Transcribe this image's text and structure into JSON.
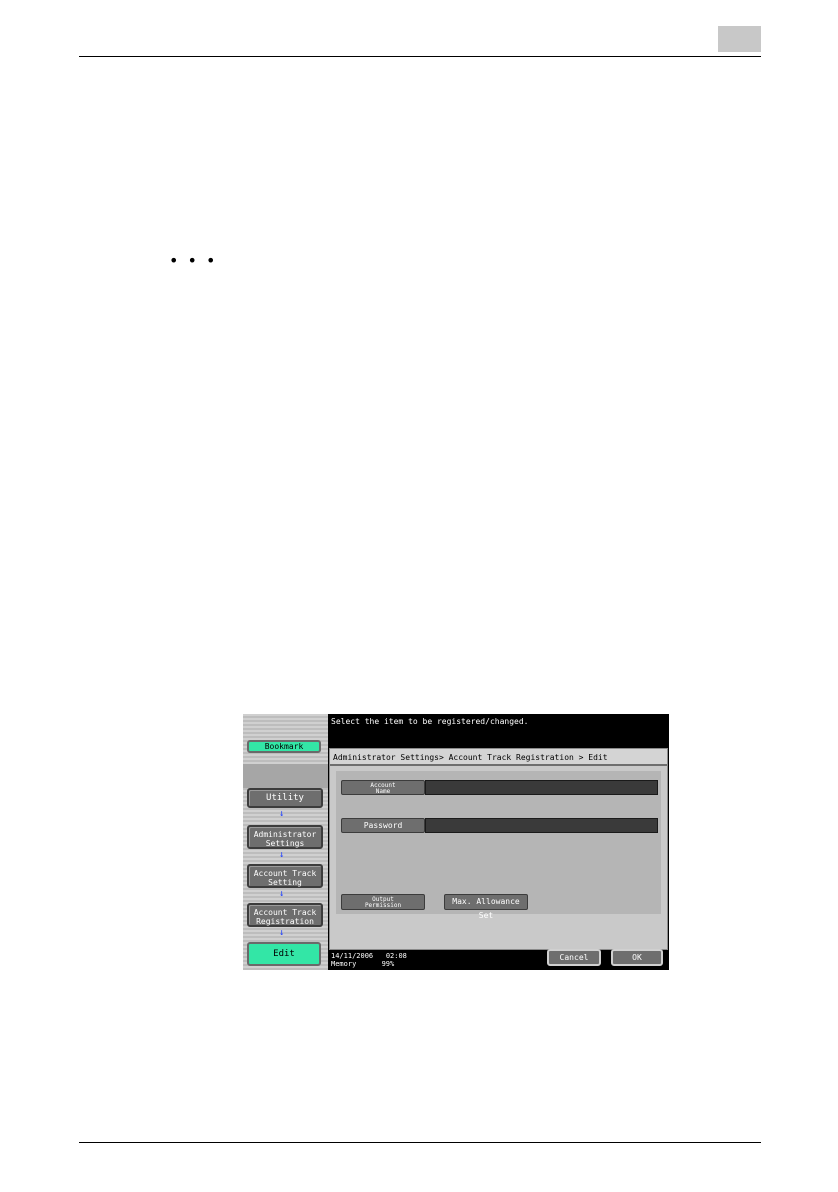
{
  "page": {
    "ellipsis": "• • •"
  },
  "panel": {
    "message": "Select the item to be registered/changed.",
    "breadcrumb": "Administrator Settings> Account Track Registration > Edit",
    "left_nav": {
      "bookmark": "Bookmark",
      "utility": "Utility",
      "admin_line1": "Administrator",
      "admin_line2": "Settings",
      "track_setting_line1": "Account Track",
      "track_setting_line2": "Setting",
      "track_reg_line1": "Account Track",
      "track_reg_line2": "Registration",
      "edit": "Edit",
      "arrow": "↓"
    },
    "fields": {
      "account_name_line1": "Account",
      "account_name_line2": "Name",
      "password": "Password",
      "output_permission_line1": "Output",
      "output_permission_line2": "Permission",
      "max_allowance": "Max. Allowance Set"
    },
    "status": {
      "date": "14/11/2006",
      "time": "02:08",
      "memory_label": "Memory",
      "memory_value": "99%"
    },
    "buttons": {
      "cancel": "Cancel",
      "ok": "OK"
    },
    "colors": {
      "accent_green": "#33e6a6",
      "arrow_blue": "#1a3cff"
    }
  }
}
